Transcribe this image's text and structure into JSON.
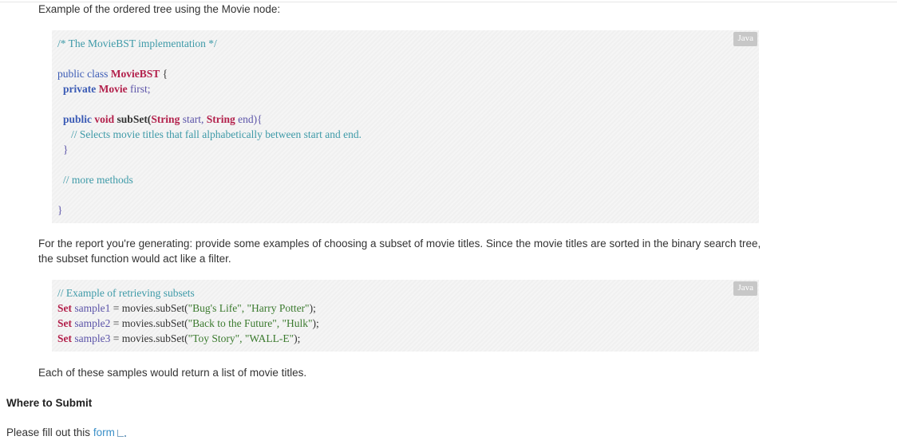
{
  "intro_text": "Example of the ordered tree using the Movie node:",
  "code1": {
    "lang": "Java",
    "comment_impl": "/* The MovieBST implementation */",
    "kw_public1": "public",
    "kw_class": "class",
    "class_name": "MovieBST",
    "brace_open": "{",
    "kw_private": "private",
    "type_movie": "Movie",
    "field_first": "first;",
    "kw_public2": "public",
    "kw_void": "void",
    "method_name": "subSet(",
    "type_string1": "String",
    "param_start": "start,",
    "type_string2": "String",
    "param_end": "end){",
    "comment_selects": "// Selects movie titles that fall alphabetically between start and end.",
    "brace_close_method": "}",
    "comment_more": "// more methods",
    "brace_close_class": "}"
  },
  "report_text": "For the report you're generating: provide some examples of choosing a subset of movie titles. Since the movie titles are sorted in the binary search tree, the subset function would act like a filter.",
  "code2": {
    "lang": "Java",
    "comment": "// Example of retrieving subsets",
    "lines": [
      {
        "type": "Set",
        "var": "sample1",
        "rest": " = movies.subSet(",
        "args": "\"Bug's Life\", \"Harry Potter\"",
        "end": ");"
      },
      {
        "type": "Set",
        "var": "sample2",
        "rest": " = movies.subSet(",
        "args": "\"Back to the Future\", \"Hulk\"",
        "end": ");"
      },
      {
        "type": "Set",
        "var": "sample3",
        "rest": " = movies.subSet(",
        "args": "\"Toy Story\", \"WALL-E\"",
        "end": ");"
      }
    ]
  },
  "samples_text": "Each of these samples would return a list of movie titles.",
  "submit_heading": "Where to Submit",
  "fill_prefix": "Please fill out this ",
  "form_link": "form"
}
